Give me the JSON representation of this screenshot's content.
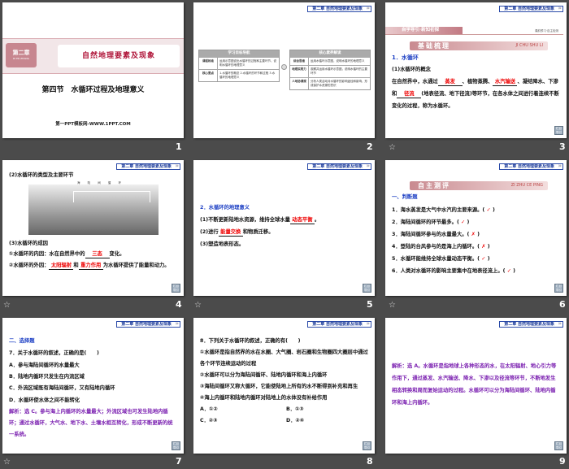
{
  "header_tag": "第二章 自然地理要素及现象",
  "back_label": "栏目导引",
  "slides": [
    {
      "number": "1",
      "chapter": "第二章",
      "chapter_pinyin": "DI ER ZHANG",
      "chapter_title": "自然地理要素及现象",
      "title": "第四节　水循环过程及地理意义",
      "footer": "第一PPT模板网-WWW.1PPT.COM"
    },
    {
      "number": "2",
      "left_table": {
        "title": "学习目标导航",
        "rows": [
          {
            "k": "课程标准",
            "v": "运用示意图说出水循环的过程和主要环节，说明水循环的地理意义"
          },
          {
            "k": "核心要点",
            "v": "1.水循环的概念 2.水循环的环节和过程 3.水循环的地理意义"
          }
        ]
      },
      "right_table": {
        "title": "核心素养解读",
        "rows": [
          {
            "k": "综合思维",
            "v": "运用水循环示意图，说明水循环的地理意义"
          },
          {
            "k": "地理实践力",
            "v": "观察并运用水循环示意图，说明水循环的主要环节"
          },
          {
            "k": "人地协调观",
            "v": "分析人类活动对水循环的影响途径和影响，形成保护水资源的意识"
          }
        ]
      }
    },
    {
      "number": "3",
      "section": "自学导引·新知初探",
      "section_right": "课前预习·自主检测",
      "banner": "基础梳理",
      "banner_pinyin": "JI CHU SHU LI",
      "h1": "1．水循环",
      "h2": "(1)水循环的概念",
      "p1": "在自然界中，水通过",
      "a1": "蒸发",
      "p2": "、植物蒸腾、",
      "a2": "水汽输送",
      "p3": "、凝结降水、下渗和",
      "a3": "径流",
      "p4": "(地表径流、地下径流)等环节，在各水体之间进行着连续不断变化的过程，称为水循环。"
    },
    {
      "number": "4",
      "h1": "(2)水循环的类型及主要环节",
      "diagram_title": "海 陆 间 循 环",
      "h2": "(3)水循环的成因",
      "l1": "①水循环的内因：水在自然界中的",
      "a1": "三态",
      "l1b": "变化。",
      "l2": "②水循环的外因：",
      "a2": "太阳辐射",
      "l2b": "和",
      "a3": "重力作用",
      "l2c": "为水循环提供了能量和动力。"
    },
    {
      "number": "5",
      "h1": "2．水循环的地理意义",
      "l1": "(1)不断更新陆地水资源，维持全球水量",
      "a1": "动态平衡",
      "l1b": "。",
      "l2": "(2)进行",
      "a2": "能量交换",
      "l2b": "和物质迁移。",
      "l3": "(3)塑造地表形态。"
    },
    {
      "number": "6",
      "banner": "自主测评",
      "banner_pinyin": "ZI ZHU CE PING",
      "h1": "一、判断题",
      "items": [
        {
          "q": "1．海水蒸发是大气中水汽的主要来源。(",
          "a": "✓"
        },
        {
          "q": "2．海陆间循环的环节最多。(",
          "a": "✓"
        },
        {
          "q": "3．海陆间循环参与的水量最大。(",
          "a": "✗"
        },
        {
          "q": "4．登陆的台风参与的是海上内循环。(",
          "a": "✗"
        },
        {
          "q": "5．水循环能维持全球水量动态平衡。(",
          "a": "✓"
        },
        {
          "q": "6．人类对水循环的影响主要集中在地表径流上。(",
          "a": "✓"
        }
      ]
    },
    {
      "number": "7",
      "h1": "二、选择题",
      "q": "7．关于水循环的叙述，正确的是(　　)",
      "opts": [
        "A．参与海陆间循环的水量最大",
        "B．陆地内循环只发生在内流区域",
        "C．外流区域既有海陆间循环，又有陆地内循环",
        "D．水循环使水体之间不能转化"
      ],
      "analysis": "解析：选 C。参与海上内循环的水量最大；外流区域也可发生陆地内循环；通过水循环，大气水、地下水、土壤水相互转化，形成不断更新的统一系统。"
    },
    {
      "number": "8",
      "q": "8．下列关于水循环的叙述，正确的有(　　)",
      "lines": [
        "①水循环是指自然界的水在水圈、大气圈、岩石圈和生物圈四大圈层中通过各个环节连续运动的过程",
        "②水循环可以分为海陆间循环、陆地内循环和海上内循环",
        "③海陆间循环又称大循环，它能使陆地上所有的水不断得到补充和再生",
        "④海上内循环和陆地内循环对陆地上的水体没有补给作用"
      ],
      "opts": [
        "A．①②",
        "B．①③",
        "C．②③",
        "D．②④"
      ]
    },
    {
      "number": "9",
      "analysis": "解析：选 A。水循环是指地球上各种形态的水，在太阳辐射、地心引力等作用下，通过蒸发、水汽输送、降水、下渗以及径流等环节，不断地发生相态转换和周而复始运动的过程。水循环可以分为海陆间循环、陆地内循环和海上内循环。"
    }
  ]
}
